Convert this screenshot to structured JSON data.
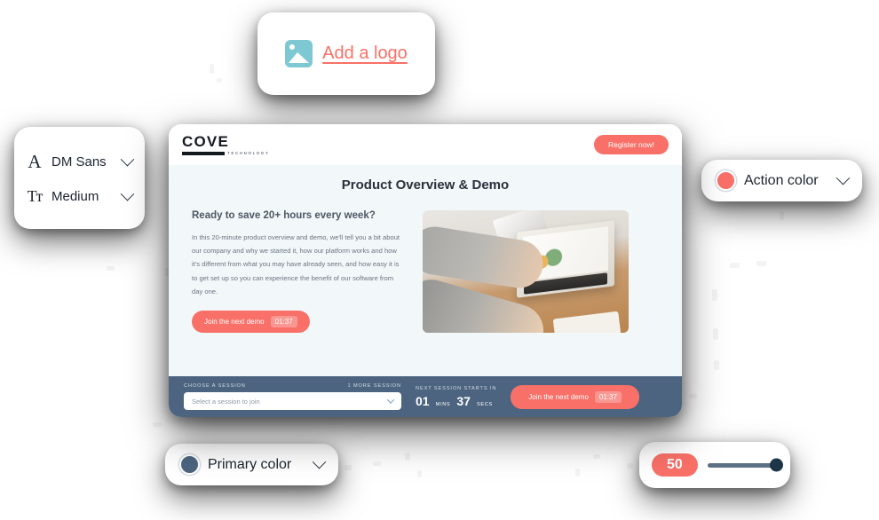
{
  "logo_card": {
    "icon": "image-placeholder-icon",
    "label": "Add a logo"
  },
  "font_card": {
    "family_icon": "letter-a-icon",
    "family": "DM Sans",
    "weight_icon": "text-size-icon",
    "weight": "Medium",
    "chevron_icon": "chevron-down-icon"
  },
  "action_color_card": {
    "label": "Action color",
    "swatch": "#f97068",
    "chevron_icon": "chevron-down-icon"
  },
  "primary_color_card": {
    "label": "Primary color",
    "swatch": "#4c6480",
    "chevron_icon": "chevron-down-icon"
  },
  "slider_card": {
    "value": "50",
    "percent": 100
  },
  "app": {
    "header": {
      "brand_name": "COVE",
      "brand_sub": "TECHNOLOGY",
      "register_label": "Register now!"
    },
    "body": {
      "title": "Product Overview & Demo",
      "subhead": "Ready to save 20+ hours every week?",
      "paragraph": "In this 20-minute product overview and demo, we'll tell you a bit about our company and why we started it, how our platform works and how it's different from what you may have already seen, and how easy it is to get set up so you can experience the benefit of our software from day one.",
      "cta_label": "Join the next demo",
      "cta_timer": "01:37",
      "photo": "team-working-on-laptop-photo"
    },
    "footer": {
      "session_label": "CHOOSE A SESSION",
      "more_sessions": "1 MORE SESSION",
      "select_placeholder": "Select a session to join",
      "next_session_label": "NEXT SESSION STARTS IN",
      "minutes": "01",
      "minutes_unit": "MINS",
      "seconds": "37",
      "seconds_unit": "SECS",
      "cta_label": "Join the next demo",
      "cta_timer": "01:37"
    }
  }
}
